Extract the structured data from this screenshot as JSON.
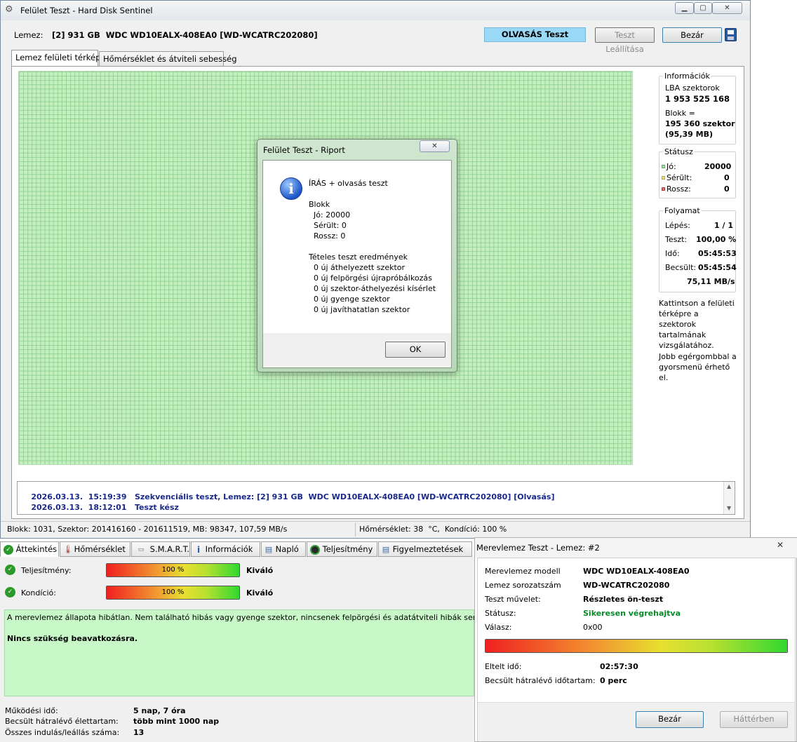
{
  "main": {
    "title": "Felület Teszt - Hard Disk Sentinel",
    "disk_label": "Lemez:",
    "disk_value": "[2] 931 GB  WDC WD10EALX-408EA0 [WD-WCATRC202080]",
    "status_banner": "OLVASÁS Teszt",
    "stop_button": "Teszt Leállítása",
    "close_button": "Bezár",
    "tabs": [
      "Lemez felületi térkép",
      "Hőmérséklet és átviteli sebesség"
    ],
    "colors": {
      "good": "#9ee09e",
      "damaged": "#e8e070",
      "bad": "#f06868",
      "banner": "#9ad8f8"
    }
  },
  "info": {
    "title": "Információk",
    "lba_label": "LBA szektorok",
    "lba_value": "1 953 525 168",
    "block_label": "Blokk =",
    "block_value": "195 360 szektor",
    "block_size": "(95,39 MB)"
  },
  "status": {
    "title": "Státusz",
    "good_label": "Jó:",
    "good_value": "20000",
    "damaged_label": "Sérült:",
    "damaged_value": "0",
    "bad_label": "Rossz:",
    "bad_value": "0"
  },
  "progress": {
    "title": "Folyamat",
    "step_label": "Lépés:",
    "step_value": "1 / 1",
    "test_label": "Teszt:",
    "test_value": "100,00 %",
    "time_label": "Idő:",
    "time_value": "05:45:53",
    "est_label": "Becsült:",
    "est_value": "05:45:54",
    "speed": "75,11 MB/s"
  },
  "hints": {
    "click": "Kattintson a felületi térképre a szektorok tartalmának vizsgálatához.",
    "right": "Jobb egérgombbal a gyorsmenü érhető el."
  },
  "log": [
    {
      "time": "2026.03.13.  15:19:39",
      "text": "Szekvenciális teszt, Lemez: [2] 931 GB  WDC WD10EALX-408EA0 [WD-WCATRC202080] [Olvasás]"
    },
    {
      "time": "2026.03.13.  18:12:01",
      "text": "Teszt kész"
    }
  ],
  "statusbar": {
    "left": "Blokk: 1031, Szektor: 201416160 - 201611519, MB: 98347, 107,59 MB/s",
    "right": "Hőmérséklet: 38  °C,  Kondíció: 100 %"
  },
  "dialog": {
    "title": "Felület Teszt - Riport",
    "heading": "ÍRÁS + olvasás teszt",
    "block_title": "Blokk",
    "good": "Jó: 20000",
    "damaged": "Sérült: 0",
    "bad": "Rossz: 0",
    "results_title": "Tételes teszt eredmények",
    "results": [
      "0 új áthelyezett szektor",
      "0 új felpörgési újrapróbálkozás",
      "0 új szektor-áthelyezési kísérlet",
      "0 új gyenge szektor",
      "0 új javíthatatlan szektor"
    ],
    "ok": "OK"
  },
  "bottom": {
    "tabs": [
      "Áttekintés",
      "Hőmérséklet",
      "S.M.A.R.T.",
      "Információk",
      "Napló",
      "Teljesítmény",
      "Figyelmeztetések"
    ],
    "performance_label": "Teljesítmény:",
    "performance_value": "100 %",
    "performance_percent": 100,
    "performance_rating": "Kiváló",
    "health_label": "Kondíció:",
    "health_value": "100 %",
    "health_percent": 100,
    "health_rating": "Kiváló",
    "message": "A merevlemez állapota hibátlan. Nem található hibás vagy gyenge szektor, nincsenek felpörgési és adatátviteli hibák sem.",
    "message_bold": "Nincs szükség beavatkozásra.",
    "uptime_label": "Működési idő:",
    "uptime_value": "5 nap, 7 óra",
    "lifetime_label": "Becsült hátralévő élettartam:",
    "lifetime_value": "több mint 1000 nap",
    "starts_label": "Összes indulás/leállás száma:",
    "starts_value": "13"
  },
  "testwin": {
    "title": "Merevlemez Teszt - Lemez: #2",
    "model_label": "Merevlemez modell",
    "model_value": "WDC WD10EALX-408EA0",
    "serial_label": "Lemez sorozatszám",
    "serial_value": "WD-WCATRC202080",
    "op_label": "Teszt művelet:",
    "op_value": "Részletes ön-teszt",
    "status_label": "Státusz:",
    "status_value": "Sikeresen végrehajtva",
    "response_label": "Válasz:",
    "response_value": "0x00",
    "progress_percent": 100,
    "elapsed_label": "Eltelt idő:",
    "elapsed_value": "02:57:30",
    "remaining_label": "Becsült hátralévő időtartam:",
    "remaining_value": "0 perc",
    "close": "Bezár",
    "background": "Háttérben"
  }
}
